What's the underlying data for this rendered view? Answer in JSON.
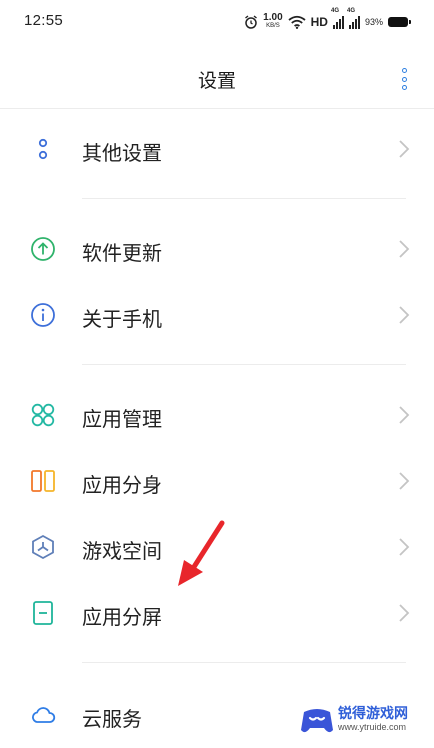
{
  "status_bar": {
    "time": "12:55",
    "net_speed_value": "1.00",
    "net_speed_unit": "KB/S",
    "hd": "HD",
    "sim1": "4G",
    "sim2": "4G",
    "battery": "93%"
  },
  "header": {
    "title": "设置",
    "more_icon": "more-vertical-icon"
  },
  "rows": [
    {
      "label": "其他设置",
      "icon": "more-settings-icon",
      "color": "#3d6fd9"
    },
    {
      "label": "软件更新",
      "icon": "update-arrow-icon",
      "color": "#2fb36b"
    },
    {
      "label": "关于手机",
      "icon": "info-icon",
      "color": "#3d6fd9"
    },
    {
      "label": "应用管理",
      "icon": "app-grid-icon",
      "color": "#23b8a3"
    },
    {
      "label": "应用分身",
      "icon": "dual-app-icon",
      "color": "#f2782a"
    },
    {
      "label": "游戏空间",
      "icon": "game-space-icon",
      "color": "#5f7fb8"
    },
    {
      "label": "应用分屏",
      "icon": "split-screen-icon",
      "color": "#1fb59a"
    },
    {
      "label": "云服务",
      "icon": "cloud-icon",
      "color": "#2f7de6"
    }
  ],
  "watermark": {
    "name": "锐得游戏网",
    "url": "www.ytruide.com"
  },
  "colors": {
    "accent": "#2e7fe0",
    "arrow": "#e8262b"
  }
}
